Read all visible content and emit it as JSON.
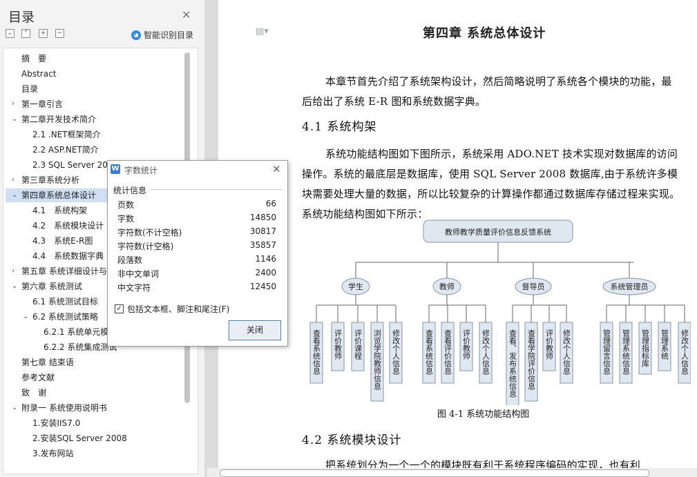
{
  "nav": {
    "title": "目录",
    "smart_label": "智能识别目录",
    "smart_icon": "ai-icon",
    "items": [
      {
        "label": "摘　要",
        "level": 1,
        "expand": ""
      },
      {
        "label": "Abstract",
        "level": 1,
        "expand": ""
      },
      {
        "label": "目录",
        "level": 1,
        "expand": ""
      },
      {
        "label": "第一章引言",
        "level": 1,
        "expand": "collapsed"
      },
      {
        "label": "第二章开发技术简介",
        "level": 1,
        "expand": "expanded"
      },
      {
        "label": "2.1 .NET框架简介",
        "level": 2,
        "expand": ""
      },
      {
        "label": "2.2 ASP.NET简介",
        "level": 2,
        "expand": ""
      },
      {
        "label": "2.3 SQL Server 2008",
        "level": 2,
        "expand": ""
      },
      {
        "label": "第三章系统分析",
        "level": 1,
        "expand": "collapsed"
      },
      {
        "label": "第四章系统总体设计",
        "level": 1,
        "expand": "expanded",
        "selected": true
      },
      {
        "label": "4.1　系统构架",
        "level": 2,
        "expand": ""
      },
      {
        "label": "4.2　系统模块设计",
        "level": 2,
        "expand": ""
      },
      {
        "label": "4.3　系统E-R图",
        "level": 2,
        "expand": ""
      },
      {
        "label": "4.4　系统数据字典",
        "level": 2,
        "expand": ""
      },
      {
        "label": "第五章 系统详细设计与",
        "level": 1,
        "expand": "collapsed"
      },
      {
        "label": "第六章 系统测试",
        "level": 1,
        "expand": "expanded"
      },
      {
        "label": "6.1 系统测试目标",
        "level": 2,
        "expand": ""
      },
      {
        "label": "6.2 系统测试策略",
        "level": 2,
        "expand": "expanded"
      },
      {
        "label": "6.2.1 系统单元模",
        "level": 3,
        "expand": ""
      },
      {
        "label": "6.2.2 系统集成测试",
        "level": 3,
        "expand": ""
      },
      {
        "label": "第七章 结束语",
        "level": 1,
        "expand": ""
      },
      {
        "label": "参考文献",
        "level": 1,
        "expand": ""
      },
      {
        "label": "致　谢",
        "level": 1,
        "expand": ""
      },
      {
        "label": "附录一 系统使用说明书",
        "level": 1,
        "expand": "expanded"
      },
      {
        "label": "1.安装IIS7.0",
        "level": 2,
        "expand": ""
      },
      {
        "label": "2.安装SQL Server 2008",
        "level": 2,
        "expand": ""
      },
      {
        "label": "3.发布网站",
        "level": 2,
        "expand": ""
      }
    ]
  },
  "doc": {
    "chapter_title": "第四章  系统总体设计",
    "intro": "本章节首先介绍了系统架构设计，然后简略说明了系统各个模块的功能，最后给出了系统 E-R 图和系统数据字典。",
    "h_41": "4.1  系统构架",
    "p_41": "系统功能结构图如下图所示，系统采用 ADO.NET 技术实现对数据库的访问操作。系统的最底层是数据库，使用 SQL Server 2008 数据库,由于系统许多模块需要处理大量的数据，所以比较复杂的计算操作都通过数据库存储过程来实现。系统功能结构图如下所示：",
    "caption": "图 4-1  系统功能结构图",
    "h_42": "4.2  系统模块设计",
    "p_42": "把系统划分为一个一个的模块既有利于系统程序编码的实现，也有利"
  },
  "diagram": {
    "root": "教师教学质量评价信息反馈系统",
    "groups": [
      {
        "label": "学生",
        "children": [
          "查看系统信息",
          "评价教师",
          "评价课程",
          "浏览学院教师信息",
          "修改个人信息"
        ]
      },
      {
        "label": "教师",
        "children": [
          "查看系统信息",
          "查看评价信息",
          "评价教师",
          "修改个人信息"
        ]
      },
      {
        "label": "督导员",
        "children": [
          "查看、发布系统信息",
          "查看学院评价信息",
          "评价教师",
          "修改个人信息"
        ]
      },
      {
        "label": "系统管理员",
        "children": [
          "管理留言信息",
          "管理系统信息",
          "管理指标库",
          "管理系统",
          "修改个人信息"
        ]
      }
    ]
  },
  "dialog": {
    "title": "字数统计",
    "group_label": "统计信息",
    "rows": [
      {
        "k": "页数",
        "v": "66"
      },
      {
        "k": "字数",
        "v": "14850"
      },
      {
        "k": "字符数(不计空格)",
        "v": "30817"
      },
      {
        "k": "字符数(计空格)",
        "v": "35857"
      },
      {
        "k": "段落数",
        "v": "1146"
      },
      {
        "k": "非中文单词",
        "v": "2400"
      },
      {
        "k": "中文字符",
        "v": "12450"
      }
    ],
    "checkbox_label": "包括文本框、脚注和尾注(F)",
    "checkbox_checked": true,
    "close_label": "关闭"
  }
}
